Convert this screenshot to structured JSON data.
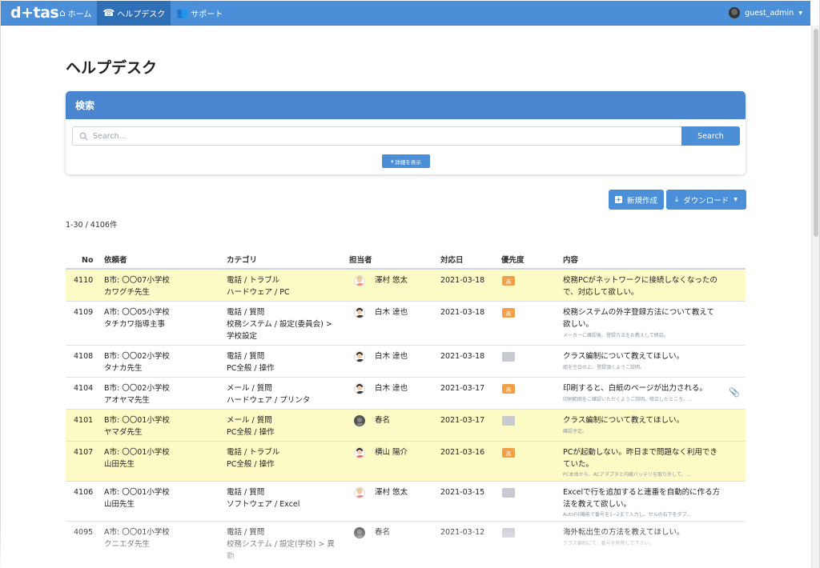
{
  "nav": {
    "logo": "d+tas",
    "items": [
      {
        "label": "ホーム",
        "icon": "home-icon"
      },
      {
        "label": "ヘルプデスク",
        "icon": "phone-icon"
      },
      {
        "label": "サポート",
        "icon": "users-icon"
      }
    ],
    "user": "guest_admin"
  },
  "page": {
    "title": "ヘルプデスク"
  },
  "search": {
    "header": "検索",
    "placeholder": "Search...",
    "button": "Search",
    "detail_button": "詳細を表示"
  },
  "actions": {
    "new": "新規作成",
    "download": "ダウンロード"
  },
  "count": "1-30 / 4106件",
  "table": {
    "headers": {
      "no": "No",
      "requester": "依頼者",
      "category": "カテゴリ",
      "assignee": "担当者",
      "date": "対応日",
      "priority": "優先度",
      "content": "内容"
    },
    "rows": [
      {
        "no": "4110",
        "req1": "B市: 〇〇07小学校",
        "req2": "カワグチ先生",
        "cat1": "電話 / トラブル",
        "cat2": "ハードウェア / PC",
        "cat3": "",
        "assignee": "澤村 悠太",
        "date": "2021-03-18",
        "priority": "高",
        "c1": "校務PCがネットワークに接続しなくなったの",
        "c2": "で、対応して欲しい。",
        "memo": ""
      },
      {
        "no": "4109",
        "req1": "A市: 〇〇05小学校",
        "req2": "タチカワ指導主事",
        "cat1": "電話 / 質問",
        "cat2": "校務システム / 設定(委員会) >",
        "cat3": "学校設定",
        "assignee": "白木 達也",
        "date": "2021-03-18",
        "priority": "高",
        "c1": "校務システムの外字登録方法について教えて",
        "c2": "欲しい。",
        "memo": "メーカーに確認後、登録方法をお教えして終話。"
      },
      {
        "no": "4108",
        "req1": "B市: 〇〇02小学校",
        "req2": "タナカ先生",
        "cat1": "電話 / 質問",
        "cat2": "PC全般 / 操作",
        "cat3": "",
        "assignee": "白木 達也",
        "date": "2021-03-18",
        "priority": "-",
        "c1": "クラス編制について教えてほしい。",
        "c2": "",
        "memo": "組を空白の上、登録頂くようご説明。"
      },
      {
        "no": "4104",
        "req1": "B市: 〇〇02小学校",
        "req2": "アオヤマ先生",
        "cat1": "メール / 質問",
        "cat2": "ハードウェア / プリンタ",
        "cat3": "",
        "assignee": "白木 達也",
        "date": "2021-03-17",
        "priority": "高",
        "c1": "印刷すると、白紙のページが出力される。",
        "c2": "",
        "memo": "印刷範囲をご確認いただくようご説明。修正したところ、..."
      },
      {
        "no": "4101",
        "req1": "B市: 〇〇01小学校",
        "req2": "ヤマダ先生",
        "cat1": "メール / 質問",
        "cat2": "PC全般 / 操作",
        "cat3": "",
        "assignee": "春名",
        "date": "2021-03-17",
        "priority": "-",
        "c1": "クラス編制について教えてほしい。",
        "c2": "",
        "memo": "確認予定。"
      },
      {
        "no": "4107",
        "req1": "A市: 〇〇01小学校",
        "req2": "山田先生",
        "cat1": "電話 / トラブル",
        "cat2": "PC全般 / 操作",
        "cat3": "",
        "assignee": "横山 陽介",
        "date": "2021-03-16",
        "priority": "高",
        "c1": "PCが起動しない。昨日まで問題なく利用でき",
        "c2": "ていた。",
        "memo": "PC本体から、ACアダプタと内蔵バッテリを取り外して、..."
      },
      {
        "no": "4106",
        "req1": "A市: 〇〇01小学校",
        "req2": "山田先生",
        "cat1": "電話 / 質問",
        "cat2": "ソフトウェア / Excel",
        "cat3": "",
        "assignee": "澤村 悠太",
        "date": "2021-03-15",
        "priority": "-",
        "c1": "Excelで行を追加すると連番を自動的に作る方",
        "c2": "法を教えて欲しい。",
        "memo": "AutoFill機能で番号を1~2まで入力し、セルの右下をダブ..."
      },
      {
        "no": "4095",
        "req1": "A市: 〇〇01小学校",
        "req2": "クニエダ先生",
        "cat1": "電話 / 質問",
        "cat2": "校務システム / 設定(学校) > 異",
        "cat3": "動",
        "assignee": "春名",
        "date": "2021-03-12",
        "priority": "-",
        "c1": "海外転出生の方法を教えてほしい。",
        "c2": "",
        "memo": "クラス編制にて、番号を削除して下さい。"
      }
    ]
  }
}
